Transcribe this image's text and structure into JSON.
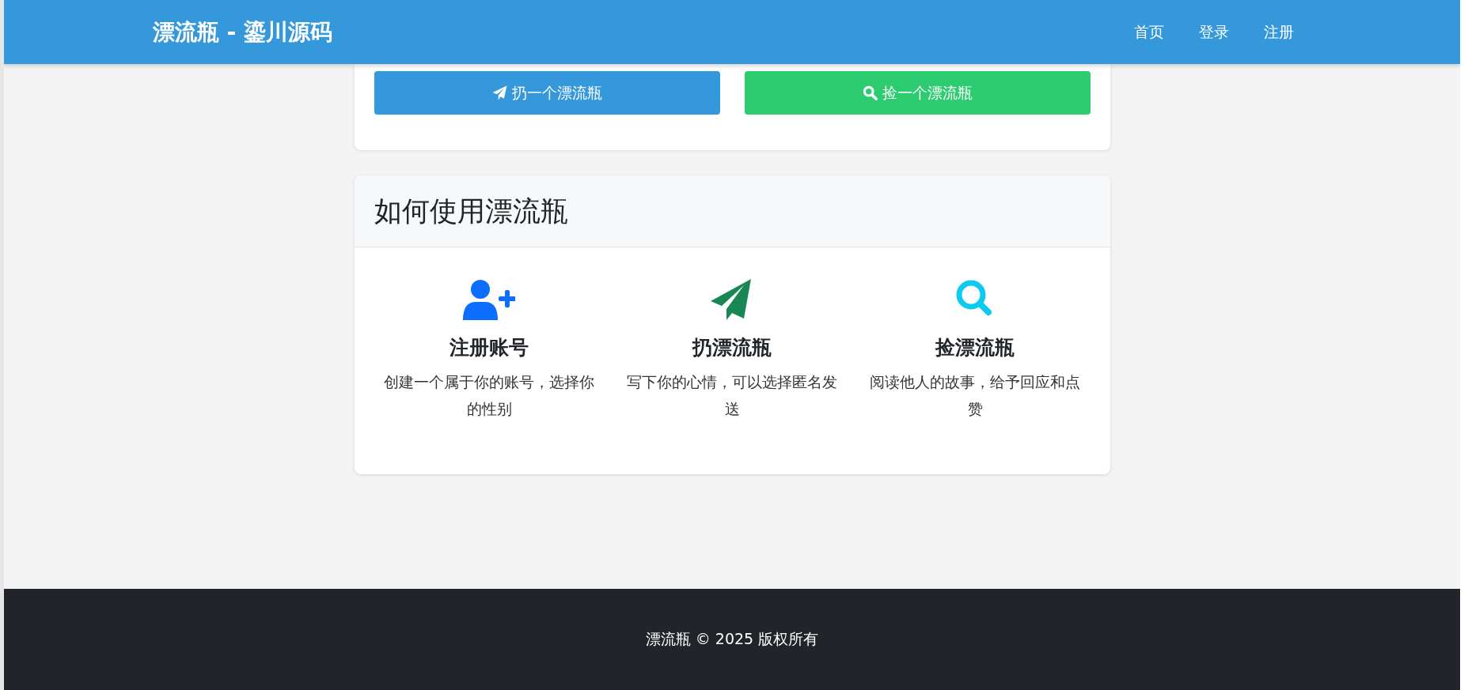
{
  "navbar": {
    "brand": "漂流瓶 - 鎏川源码",
    "links": [
      {
        "label": "首页"
      },
      {
        "label": "登录"
      },
      {
        "label": "注册"
      }
    ]
  },
  "actions": [
    {
      "kind": "throw",
      "label": "扔一个漂流瓶"
    },
    {
      "kind": "pick",
      "label": "捡一个漂流瓶"
    }
  ],
  "howto": {
    "title": "如何使用漂流瓶",
    "steps": [
      {
        "kind": "register",
        "title": "注册账号",
        "text": "创建一个属于你的账号，选择你的性别"
      },
      {
        "kind": "throw",
        "title": "扔漂流瓶",
        "text": "写下你的心情，可以选择匿名发送"
      },
      {
        "kind": "pick",
        "title": "捡漂流瓶",
        "text": "阅读他人的故事，给予回应和点赞"
      }
    ]
  },
  "footer": {
    "text": "漂流瓶 © 2025 版权所有"
  }
}
